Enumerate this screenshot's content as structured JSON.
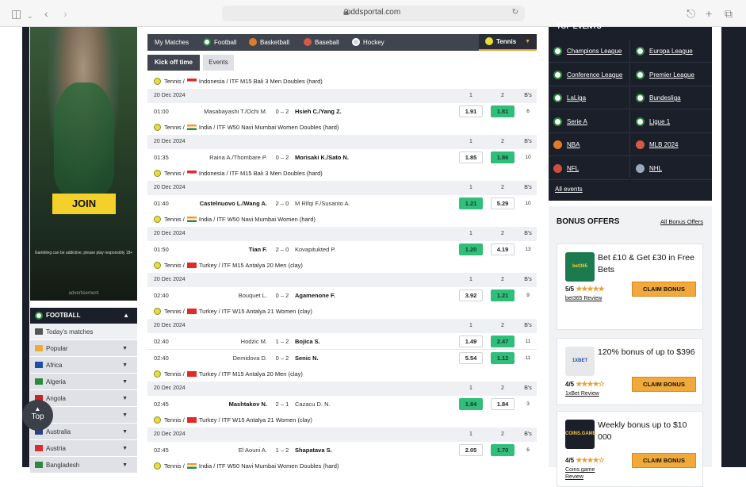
{
  "browser": {
    "url": "oddsportal.com"
  },
  "ad": {
    "join_label": "JOIN",
    "disclaimer": "Gambling can be addictive, please play responsibly 18+",
    "label": "advertisement"
  },
  "sidebar": {
    "header": "FOOTBALL",
    "items": [
      {
        "label": "Today's matches"
      },
      {
        "label": "Popular"
      },
      {
        "label": "Africa"
      },
      {
        "label": "Algeria"
      },
      {
        "label": "Angola"
      },
      {
        "label": "ia"
      },
      {
        "label": "Australia"
      },
      {
        "label": "Austria"
      },
      {
        "label": "Bangladesh"
      }
    ],
    "top_button": "Top"
  },
  "nav": {
    "items": [
      "My Matches",
      "Football",
      "Basketball",
      "Baseball",
      "Hockey"
    ],
    "active": "Tennis"
  },
  "subtabs": [
    "Kick off time",
    "Events"
  ],
  "odds_headers": {
    "h1": "1",
    "h2": "2",
    "h3": "B's"
  },
  "tournaments": [
    {
      "sport": "Tennis /",
      "country": "Indonesia",
      "name": "/ ITF M15 Bali 3 Men Doubles (hard)",
      "date": "20 Dec 2024",
      "matches": [
        {
          "time": "01:00",
          "p1": "Masabayashi T./Ochi M.",
          "score": "0 – 2",
          "p2": "Hsieh C./Yang Z.",
          "w": 2,
          "o1": "1.91",
          "o2": "1.81",
          "hi": 2,
          "bs": "6"
        }
      ]
    },
    {
      "sport": "Tennis /",
      "country": "India",
      "name": "/ ITF W50 Navi Mumbai Women Doubles (hard)",
      "date": "20 Dec 2024",
      "matches": [
        {
          "time": "01:35",
          "p1": "Raina A./Thombare P.",
          "score": "0 – 2",
          "p2": "Morisaki K./Sato N.",
          "w": 2,
          "o1": "1.85",
          "o2": "1.86",
          "hi": 2,
          "bs": "10"
        }
      ]
    },
    {
      "sport": "Tennis /",
      "country": "Indonesia",
      "name": "/ ITF M15 Bali 3 Men Doubles (hard)",
      "date": "20 Dec 2024",
      "matches": [
        {
          "time": "01:40",
          "p1": "Castelnuovo L./Wang A.",
          "score": "2 – 0",
          "p2": "M Rifqi F./Susanto A.",
          "w": 1,
          "o1": "1.21",
          "o2": "5.29",
          "hi": 1,
          "bs": "10"
        }
      ]
    },
    {
      "sport": "Tennis /",
      "country": "India",
      "name": "/ ITF W50 Navi Mumbai Women (hard)",
      "date": "20 Dec 2024",
      "matches": [
        {
          "time": "01:50",
          "p1": "Tian F.",
          "score": "2 – 0",
          "p2": "Kovapitukted P.",
          "w": 1,
          "o1": "1.20",
          "o2": "4.19",
          "hi": 1,
          "bs": "13"
        }
      ]
    },
    {
      "sport": "Tennis /",
      "country": "Turkey",
      "name": "/ ITF M15 Antalya 20 Men (clay)",
      "date": "20 Dec 2024",
      "matches": [
        {
          "time": "02:40",
          "p1": "Bouquet L.",
          "score": "0 – 2",
          "p2": "Agamenone F.",
          "w": 2,
          "o1": "3.92",
          "o2": "1.21",
          "hi": 2,
          "bs": "9"
        }
      ]
    },
    {
      "sport": "Tennis /",
      "country": "Turkey",
      "name": "/ ITF W15 Antalya 21 Women (clay)",
      "date": "20 Dec 2024",
      "matches": [
        {
          "time": "02:40",
          "p1": "Hodzic M.",
          "score": "1 – 2",
          "p2": "Bojica S.",
          "w": 2,
          "o1": "1.49",
          "o2": "2.47",
          "hi": 2,
          "bs": "11"
        },
        {
          "time": "02:40",
          "p1": "Demidova D.",
          "score": "0 – 2",
          "p2": "Senic N.",
          "w": 2,
          "o1": "5.54",
          "o2": "1.12",
          "hi": 2,
          "bs": "11"
        }
      ]
    },
    {
      "sport": "Tennis /",
      "country": "Turkey",
      "name": "/ ITF M15 Antalya 20 Men (clay)",
      "date": "20 Dec 2024",
      "matches": [
        {
          "time": "02:45",
          "p1": "Mashtakov N.",
          "score": "2 – 1",
          "p2": "Cazacu D. N.",
          "w": 1,
          "o1": "1.84",
          "o2": "1.84",
          "hi": 1,
          "bs": "3"
        }
      ]
    },
    {
      "sport": "Tennis /",
      "country": "Turkey",
      "name": "/ ITF W15 Antalya 21 Women (clay)",
      "date": "20 Dec 2024",
      "matches": [
        {
          "time": "02:45",
          "p1": "El Aouni A.",
          "score": "1 – 2",
          "p2": "Shapatava S.",
          "w": 2,
          "o1": "2.05",
          "o2": "1.70",
          "hi": 2,
          "bs": "6"
        }
      ]
    },
    {
      "sport": "Tennis /",
      "country": "India",
      "name": "/ ITF W50 Navi Mumbai Women Doubles (hard)",
      "date": "",
      "matches": []
    }
  ],
  "top_events": {
    "title": "TOP EVENTS",
    "items": [
      "Champions League",
      "Europa League",
      "Conference League",
      "Premier League",
      "LaLiga",
      "Bundesliga",
      "Serie A",
      "Ligue 1",
      "NBA",
      "MLB 2024",
      "NFL",
      "NHL"
    ],
    "all_label": "All events"
  },
  "bonus": {
    "title": "BONUS OFFERS",
    "all_label": "All Bonus Offers",
    "cards": [
      {
        "logo": "bet365",
        "offer": "Bet £10 & Get £30 in Free Bets",
        "rating": "5/5",
        "stars": "★★★★★",
        "review": "bet365 Review",
        "cta": "CLAIM BONUS",
        "color": "#1c7a4e",
        "text": "#f3d02a"
      },
      {
        "logo": "1XBET",
        "offer": "120% bonus of up to $396",
        "rating": "4/5",
        "stars": "★★★★☆",
        "review": "1xBet Review",
        "cta": "CLAIM BONUS",
        "color": "#e7e8ea",
        "text": "#1d4ea8"
      },
      {
        "logo": "COINS.GAME",
        "offer": "Weekly bonus up to $10 000",
        "rating": "4/5",
        "stars": "★★★★☆",
        "review": "Coins.game Review",
        "cta": "CLAIM BONUS",
        "color": "#1b1f2a",
        "text": "#f0c64a"
      }
    ]
  }
}
